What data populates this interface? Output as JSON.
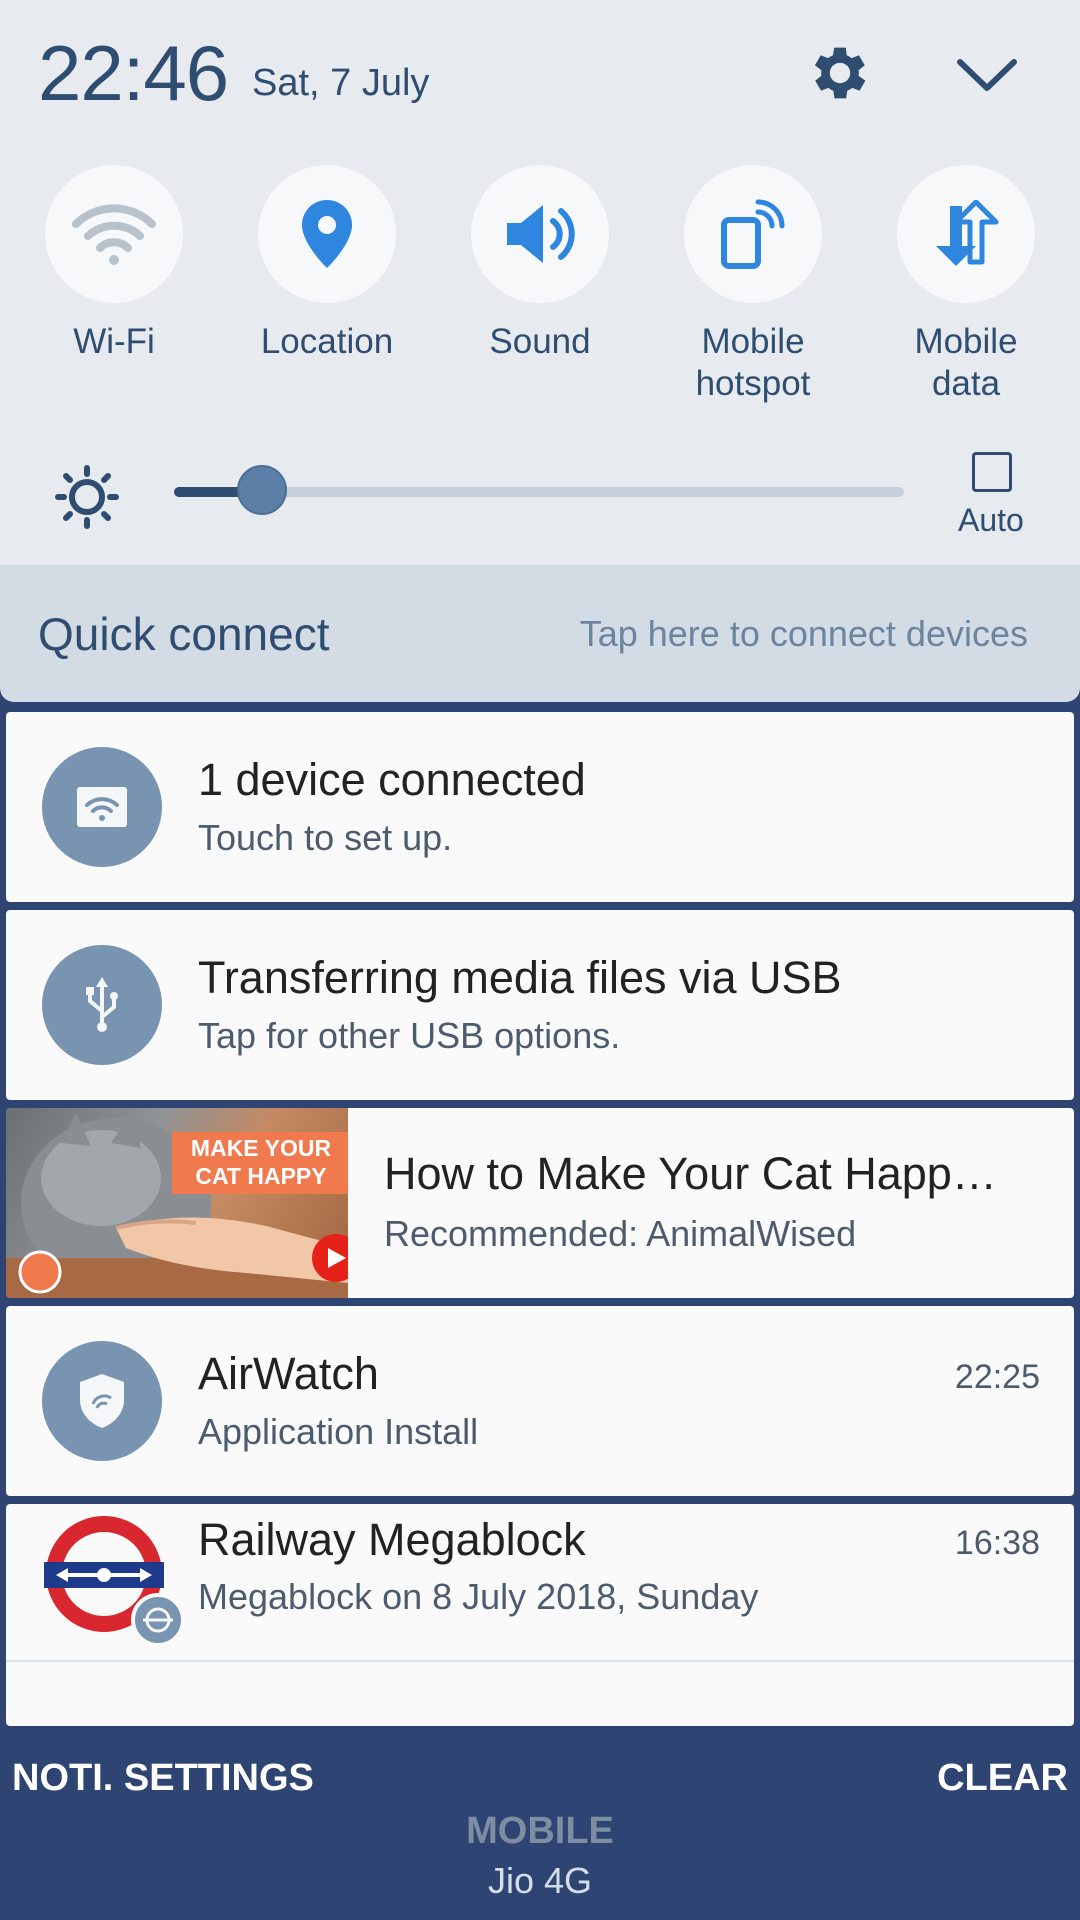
{
  "status": {
    "time": "22:46",
    "date": "Sat, 7 July"
  },
  "tiles": [
    {
      "label": "Wi-Fi",
      "icon": "wifi-icon",
      "active": false
    },
    {
      "label": "Location",
      "icon": "location-pin-icon",
      "active": true
    },
    {
      "label": "Sound",
      "icon": "speaker-icon",
      "active": true
    },
    {
      "label": "Mobile\nhotspot",
      "icon": "hotspot-icon",
      "active": true
    },
    {
      "label": "Mobile\ndata",
      "icon": "mobile-data-icon",
      "active": true
    }
  ],
  "brightness": {
    "level": 0.12,
    "auto_label": "Auto",
    "auto_checked": false
  },
  "quick_connect": {
    "title": "Quick connect",
    "hint": "Tap here to connect devices"
  },
  "notifications": [
    {
      "title": "1 device connected",
      "subtitle": "Touch to set up.",
      "icon": "wifi-hotspot-icon"
    },
    {
      "title": "Transferring media files via USB",
      "subtitle": "Tap for other USB options.",
      "icon": "usb-icon"
    },
    {
      "title": "How to Make Your Cat Happ…",
      "subtitle": "Recommended: AnimalWised",
      "thumb_text": "MAKE YOUR\nCAT HAPPY",
      "icon": "youtube-icon"
    },
    {
      "title": "AirWatch",
      "subtitle": "Application Install",
      "time": "22:25",
      "icon": "shield-icon"
    },
    {
      "title": "Railway Megablock",
      "subtitle": "Megablock on 8 July 2018, Sunday",
      "time": "16:38",
      "icon": "rail-logo-icon"
    }
  ],
  "footer": {
    "settings_label": "NOTI. SETTINGS",
    "clear_label": "CLEAR",
    "network": "MOBILE",
    "carrier": "Jio 4G"
  },
  "colors": {
    "accent": "#2f4d70",
    "panel": "#e7ebef",
    "footer": "#2e4472",
    "icon_active": "#2e86de"
  }
}
